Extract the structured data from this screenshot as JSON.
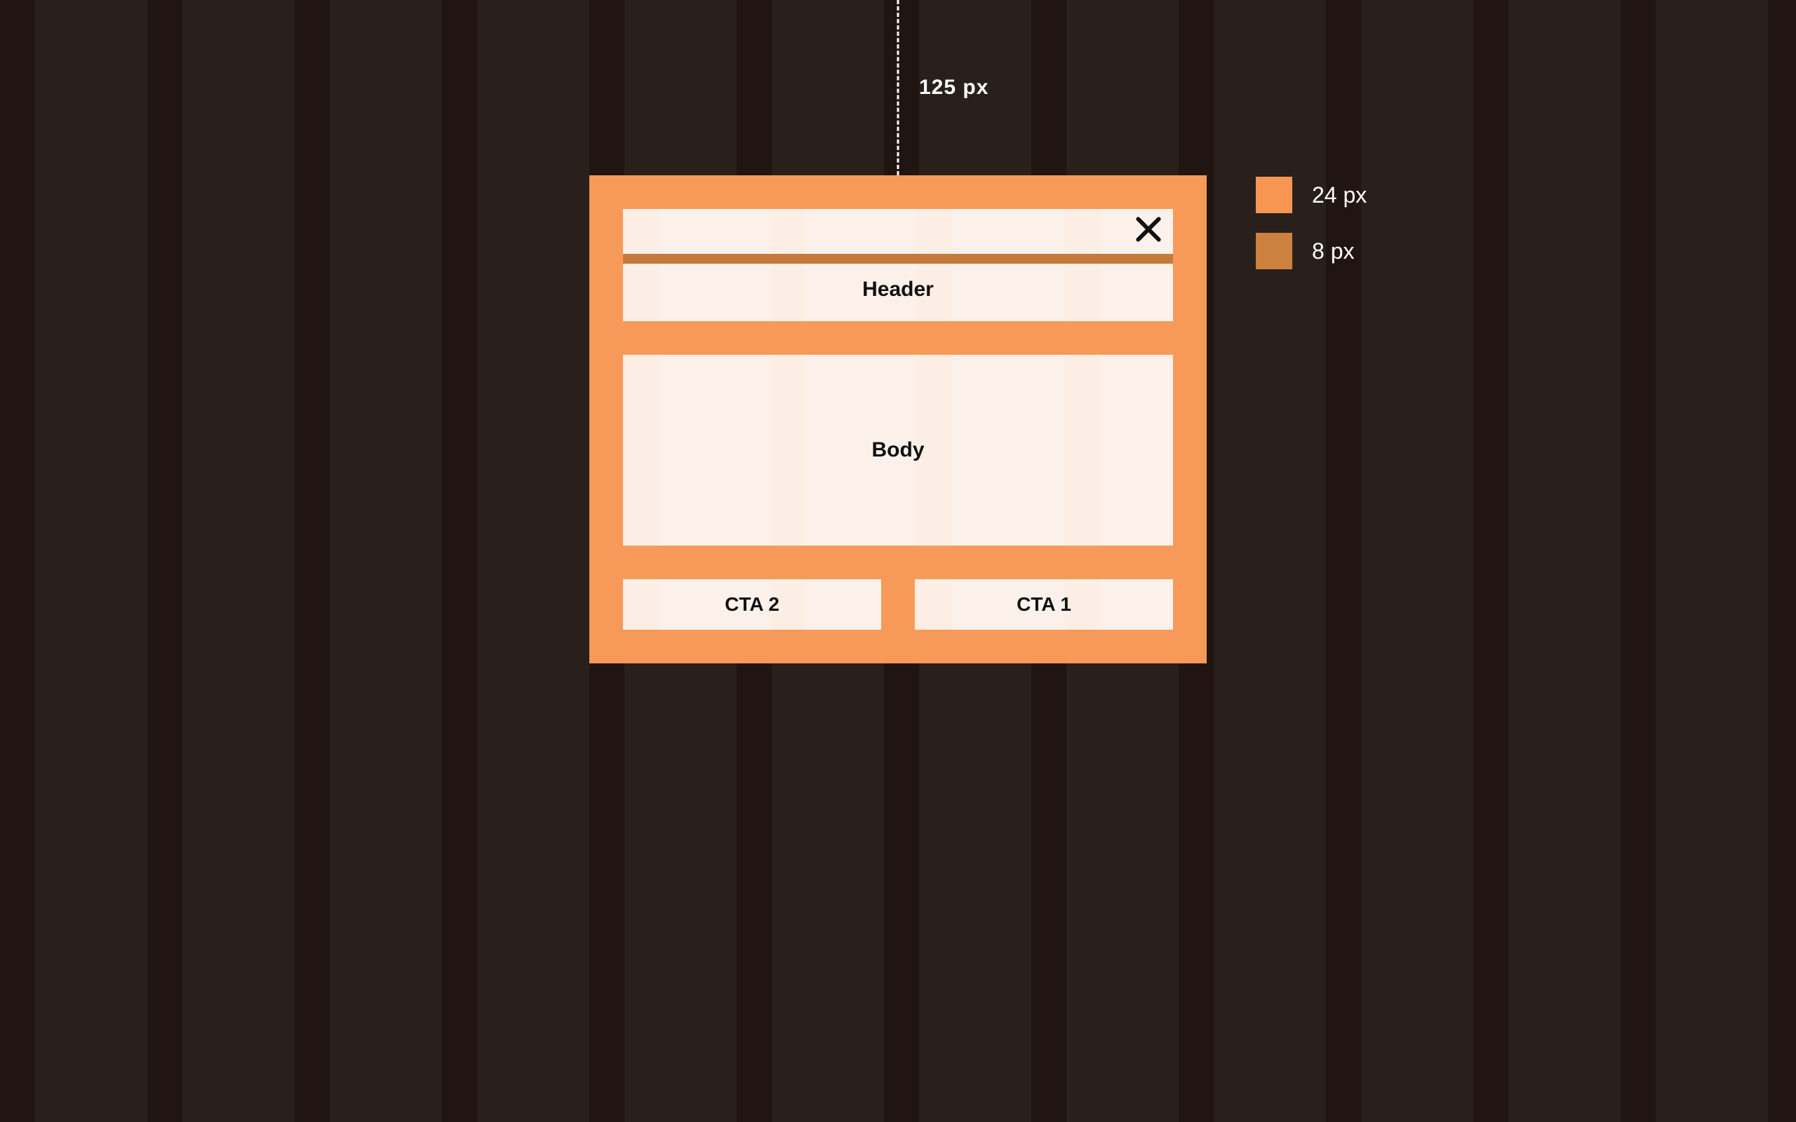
{
  "measurement": {
    "top_offset_label": "125 px"
  },
  "legend": {
    "items": [
      {
        "color": "#f79652",
        "label": "24 px"
      },
      {
        "color": "#cd813e",
        "label": "8 px"
      }
    ]
  },
  "dialog": {
    "header_label": "Header",
    "body_label": "Body",
    "cta2_label": "CTA 2",
    "cta1_label": "CTA 1"
  }
}
